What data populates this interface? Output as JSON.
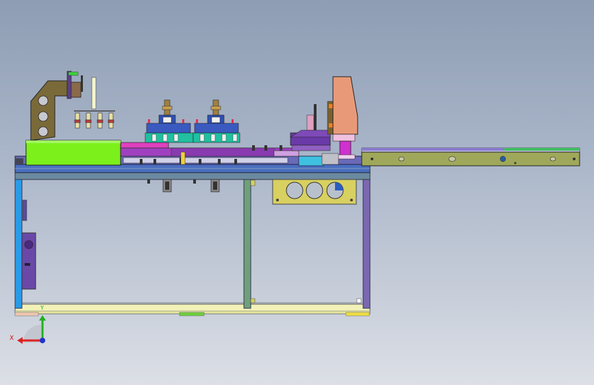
{
  "viewport": {
    "background_top": "#8e9db4",
    "background_bottom": "#dcdfe6"
  },
  "triad": {
    "x_label": "X",
    "y_label": "Y",
    "colors": {
      "x": "#e02020",
      "y": "#20b020",
      "z": "#2030d0"
    }
  },
  "model_colors": {
    "frame_blue": "#1f8fdf",
    "frame_green": "#6fa06f",
    "frame_purple": "#7b68b0",
    "frame_base": "#f0f0b0",
    "hopper_brown": "#7a6a3a",
    "lime_block": "#7cf01a",
    "salmon_block": "#e89a78",
    "conveyor_olive": "#9fa85a",
    "magenta": "#e040e0"
  }
}
